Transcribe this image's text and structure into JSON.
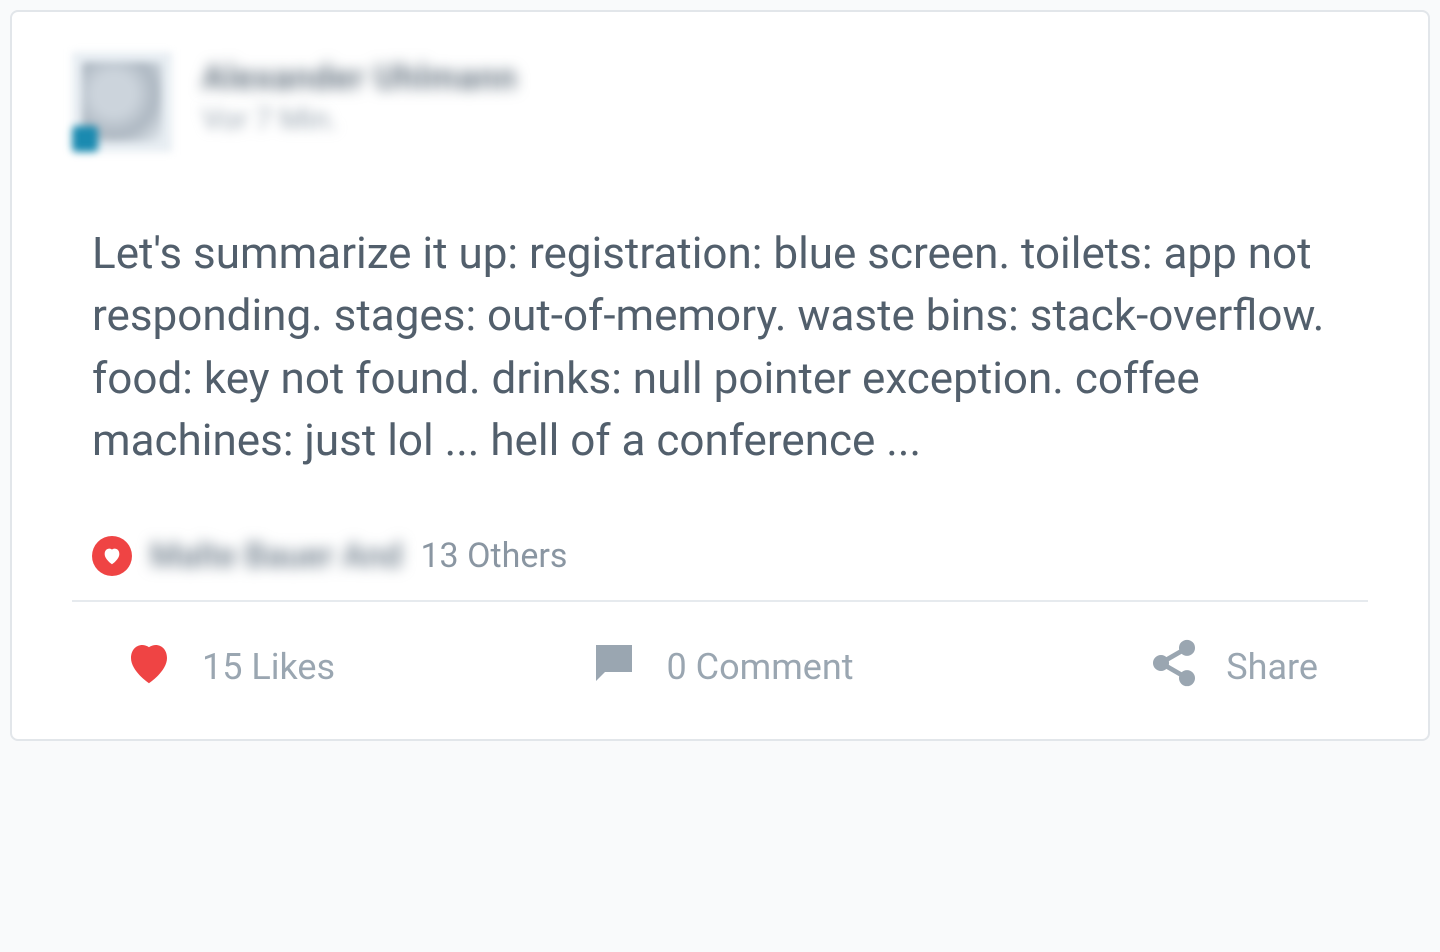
{
  "post": {
    "author_name": "Alexander Uhlmann",
    "timestamp": "Vor 7 Min.",
    "body": "Let's summarize it up: registration: blue screen. toilets: app not responding. stages: out-of-memory. waste bins: stack-overflow. food: key not found. drinks: null pointer exception. coffee machines: just lol ... hell of a conference ...",
    "likes_names": "Malte Bauer And",
    "likes_others": "13 Others",
    "like_count_label": "15 Likes",
    "comment_label": "0 Comment",
    "share_label": "Share"
  },
  "colors": {
    "heart": "#ef4444",
    "icon_gray": "#9aa6b1"
  }
}
